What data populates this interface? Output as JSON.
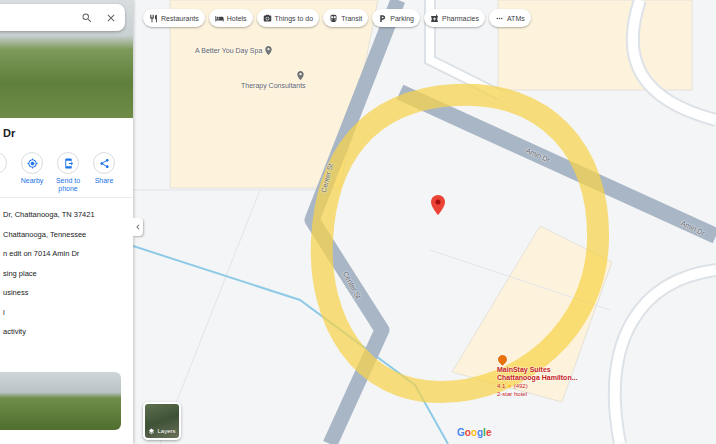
{
  "place": {
    "title": "Dr",
    "actions": [
      {
        "label": "e"
      },
      {
        "label": "Nearby"
      },
      {
        "label": "Send to phone"
      },
      {
        "label": "Share"
      }
    ],
    "details": [
      "Dr, Chattanooga, TN 37421",
      "Chattanooga, Tennessee",
      "n edit on 7014 Amin Dr",
      "sing place",
      "usiness",
      "l",
      "activity"
    ]
  },
  "filter_chips": [
    {
      "label": "Restaurants"
    },
    {
      "label": "Hotels"
    },
    {
      "label": "Things to do"
    },
    {
      "label": "Transit"
    },
    {
      "label": "Parking"
    },
    {
      "label": "Pharmacies"
    },
    {
      "label": "ATMs"
    }
  ],
  "map": {
    "road_labels": [
      {
        "name": "Center St"
      },
      {
        "name": "Center St"
      },
      {
        "name": "Amin Dr"
      },
      {
        "name": "Amin Dr"
      }
    ],
    "places": [
      {
        "name": "A Better You Day Spa",
        "kind": "poi",
        "color": "#70757a"
      },
      {
        "name": "Therapy Consultants",
        "kind": "poi",
        "color": "#70757a"
      },
      {
        "name": "MainStay Suites Chattanooga Hamilton...",
        "kind": "hotel",
        "color": "#e8710a",
        "rating": "4.1",
        "star": "★",
        "reviews": "(492)",
        "category": "2-star hotel"
      }
    ],
    "selected_pin": {
      "color": "#ea4335"
    },
    "layers_button": {
      "label": "Layers"
    },
    "logo": {
      "letters": [
        {
          "char": "G",
          "color": "#4285f4"
        },
        {
          "char": "o",
          "color": "#ea4335"
        },
        {
          "char": "o",
          "color": "#fbbc05"
        },
        {
          "char": "g",
          "color": "#4285f4"
        },
        {
          "char": "l",
          "color": "#34a853"
        },
        {
          "char": "e",
          "color": "#ea4335"
        }
      ]
    }
  }
}
